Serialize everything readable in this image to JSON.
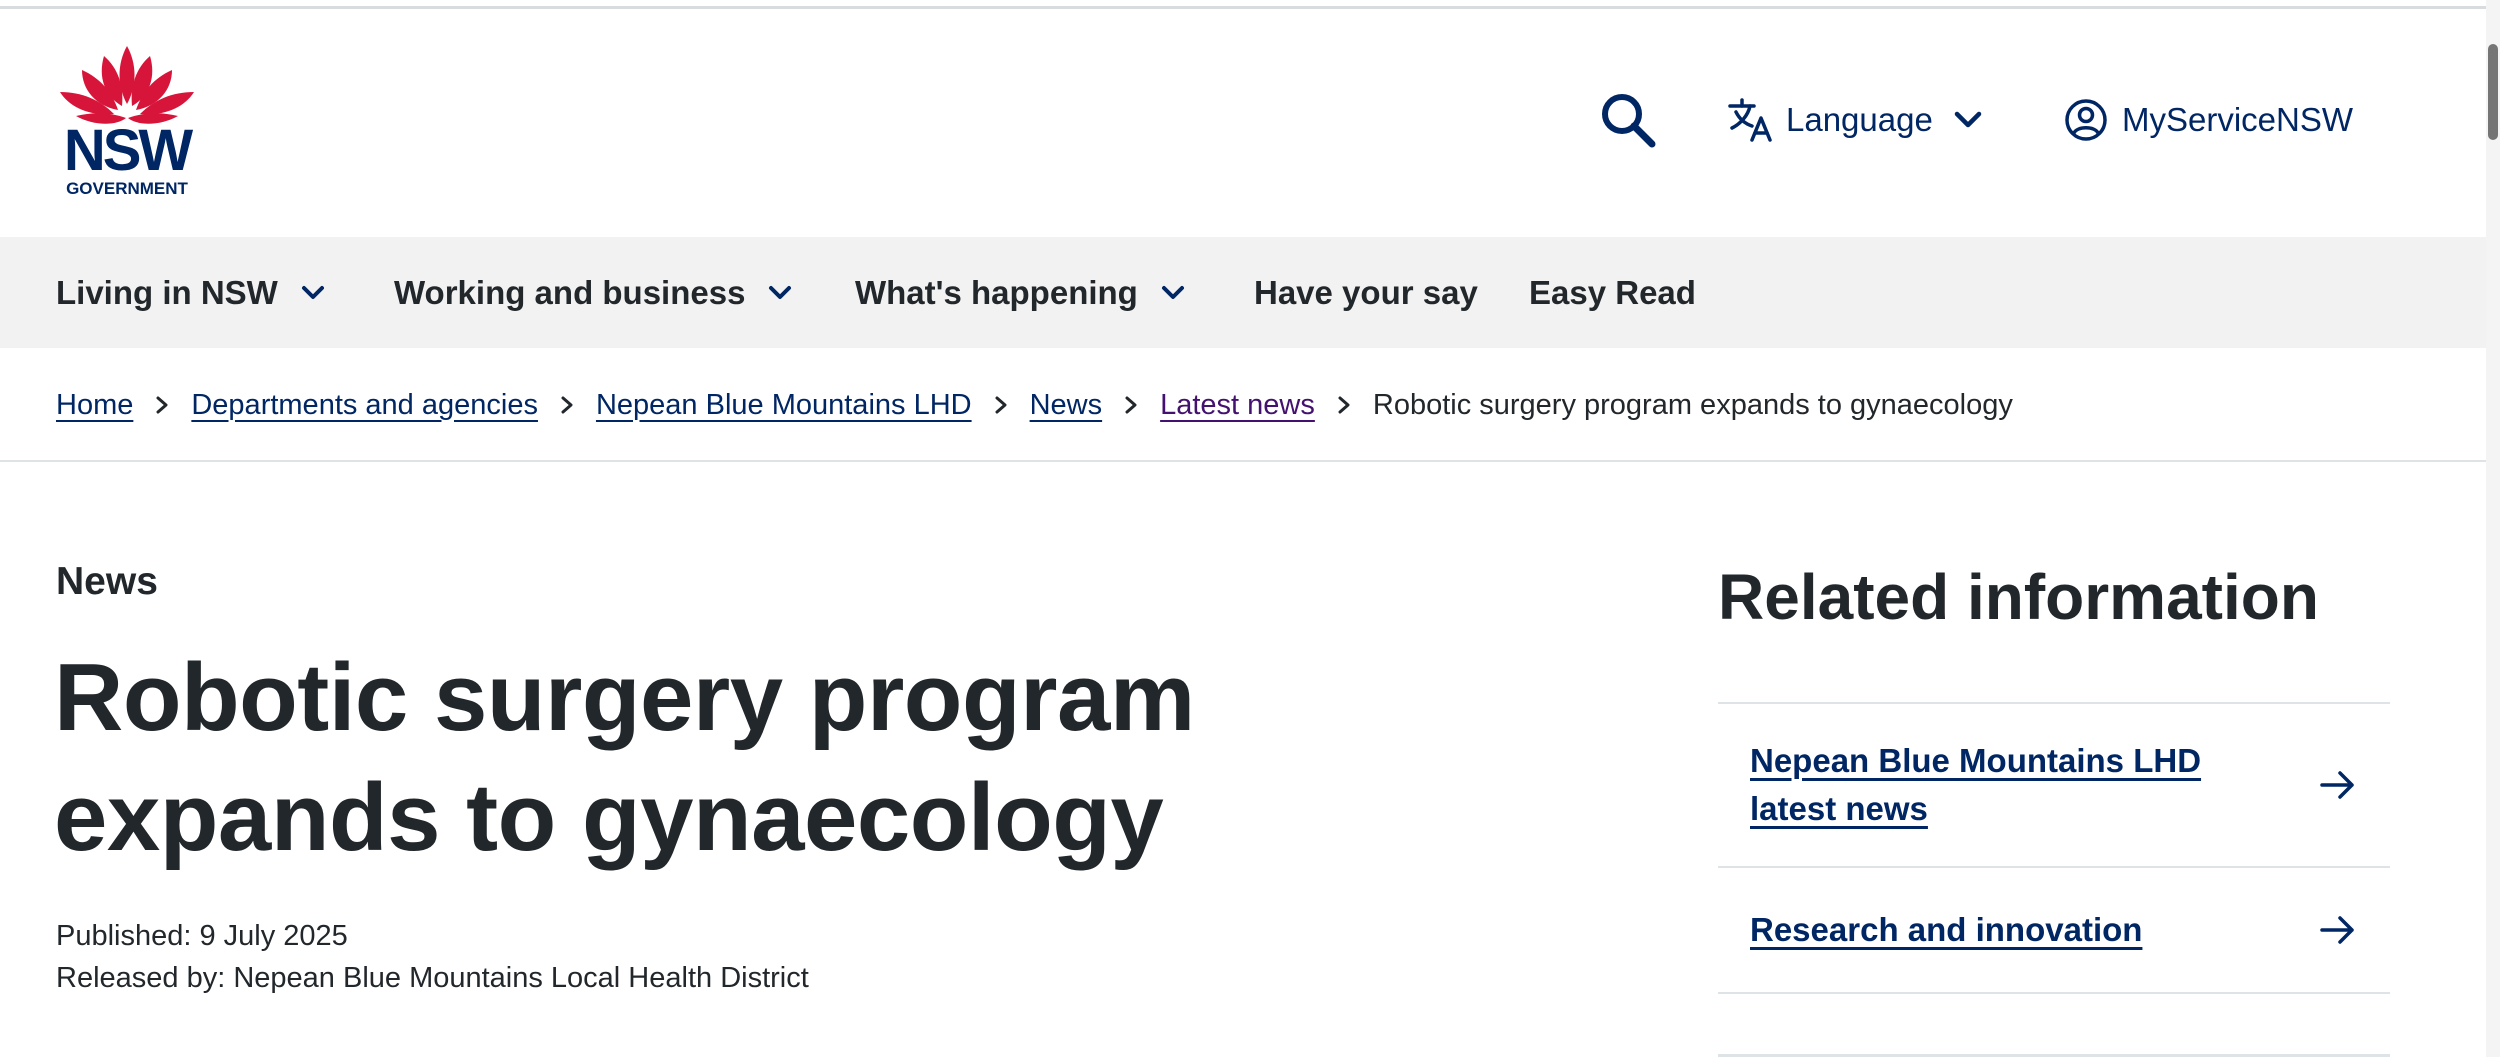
{
  "header": {
    "logo": {
      "wordmark": "NSW",
      "sub": "GOVERNMENT",
      "color": "#002664",
      "waratah_color": "#d7153a"
    },
    "search_icon": "search-icon",
    "language_label": "Language",
    "account_label": "MyServiceNSW"
  },
  "nav": {
    "items": [
      {
        "label": "Living in NSW",
        "has_dropdown": true
      },
      {
        "label": "Working and business",
        "has_dropdown": true
      },
      {
        "label": "What's happening",
        "has_dropdown": true
      },
      {
        "label": "Have your say",
        "has_dropdown": false
      },
      {
        "label": "Easy Read",
        "has_dropdown": false
      }
    ]
  },
  "breadcrumb": {
    "items": [
      {
        "label": "Home"
      },
      {
        "label": "Departments and agencies"
      },
      {
        "label": "Nepean Blue Mountains LHD"
      },
      {
        "label": "News"
      },
      {
        "label": "Latest news"
      }
    ],
    "current": "Robotic surgery program expands to gynaecology"
  },
  "article": {
    "kicker": "News",
    "title": "Robotic surgery program expands to gynaecology",
    "published": "Published: 9 July 2025",
    "released_by": "Released by: Nepean Blue Mountains Local Health District"
  },
  "sidebar": {
    "title": "Related information",
    "links": [
      {
        "label": "Nepean Blue Mountains LHD latest news"
      },
      {
        "label": "Research and innovation"
      }
    ]
  },
  "colors": {
    "brand_navy": "#002664",
    "text": "#22272b",
    "visited_link": "#441170",
    "nav_bg": "#f2f2f2"
  }
}
